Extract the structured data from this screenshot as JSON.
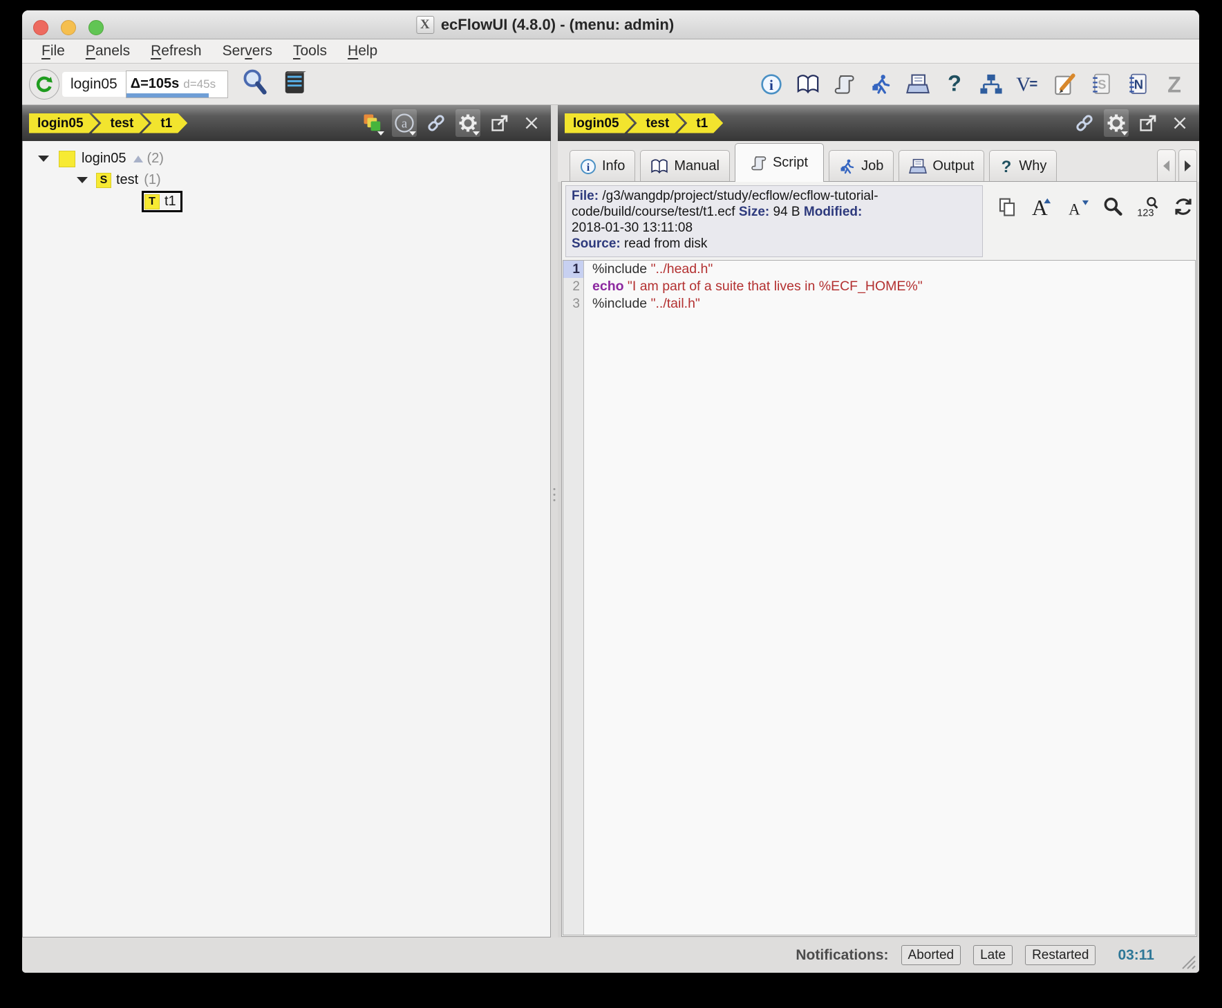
{
  "window": {
    "title": "ecFlowUI (4.8.0) - (menu: admin)"
  },
  "menu": {
    "items": [
      {
        "pre": "",
        "key": "F",
        "post": "ile"
      },
      {
        "pre": "",
        "key": "P",
        "post": "anels"
      },
      {
        "pre": "",
        "key": "R",
        "post": "efresh"
      },
      {
        "pre": "Ser",
        "key": "v",
        "post": "ers"
      },
      {
        "pre": "",
        "key": "T",
        "post": "ools"
      },
      {
        "pre": "",
        "key": "H",
        "post": "elp"
      }
    ]
  },
  "toolbar": {
    "server_label": "login05",
    "interval": "Δ=105s",
    "drift": "d=45s"
  },
  "left_panel": {
    "breadcrumbs": [
      "login05",
      "test",
      "t1"
    ],
    "tree": [
      {
        "label": "login05",
        "badge": "(2)"
      },
      {
        "icon": "S",
        "label": "test",
        "badge": "(1)"
      },
      {
        "icon": "T",
        "label": "t1"
      }
    ]
  },
  "right_panel": {
    "breadcrumbs": [
      "login05",
      "test",
      "t1"
    ],
    "tabs": [
      "Info",
      "Manual",
      "Script",
      "Job",
      "Output",
      "Why"
    ],
    "file_info": {
      "file_label": "File:",
      "file_value": "/g3/wangdp/project/study/ecflow/ecflow-tutorial-code/build/course/test/t1.ecf",
      "size_label": "Size:",
      "size_value": "94 B",
      "modified_label": "Modified:",
      "modified_value": "2018-01-30 13:11:08",
      "source_label": "Source:",
      "source_value": "read from disk"
    },
    "code": {
      "lines": [
        {
          "num": "1",
          "parts": [
            {
              "text": "%include "
            },
            {
              "text": "\"../head.h\""
            }
          ]
        },
        {
          "num": "2",
          "parts": [
            {
              "text": "echo"
            },
            {
              "text": " \"I am part of a suite that lives in %ECF_HOME%\""
            }
          ]
        },
        {
          "num": "3",
          "parts": [
            {
              "text": "%include "
            },
            {
              "text": "\"../tail.h\""
            }
          ]
        }
      ]
    }
  },
  "status_bar": {
    "label": "Notifications:",
    "buttons": [
      "Aborted",
      "Late",
      "Restarted"
    ],
    "time": "03:11"
  },
  "icons": {
    "toolbar_left": [
      "refresh-icon",
      "search-icon",
      "server-icon"
    ],
    "toolbar_right": [
      "info-icon",
      "manual-book-icon",
      "script-icon",
      "job-runner-icon",
      "output-printer-icon",
      "why-question-icon",
      "tree-view-icon",
      "variables-icon",
      "edit-icon",
      "s-notebook-icon",
      "n-notebook-icon",
      "z-icon"
    ],
    "panel_header": [
      "layers-icon",
      "attribute-at-icon",
      "link-icon",
      "gear-icon",
      "detach-icon",
      "close-icon"
    ],
    "file_toolbar": [
      "copy-icon",
      "font-increase-icon",
      "font-decrease-icon",
      "search-icon",
      "goto-line-icon",
      "reload-icon"
    ]
  },
  "colors": {
    "crumb_yellow": "#f2e42e",
    "node_yellow": "#f7ea33",
    "string_red": "#b33030",
    "keyword_purple": "#8c28a0",
    "time_blue": "#2e7797",
    "progress_blue": "#6f9ed6"
  }
}
